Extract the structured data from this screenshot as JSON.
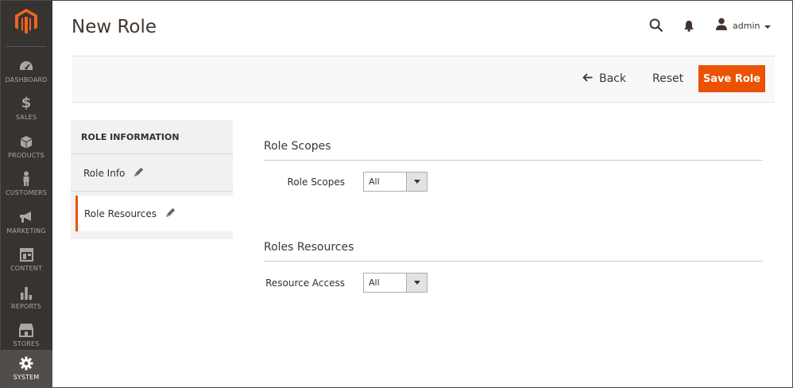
{
  "app": {
    "brand_color": "#eb5202",
    "sidebar_color": "#373330",
    "logo_icon": "magento-logo-icon"
  },
  "sidebar": {
    "items": [
      {
        "label": "DASHBOARD",
        "icon": "dashboard-icon"
      },
      {
        "label": "SALES",
        "icon": "dollar-icon"
      },
      {
        "label": "PRODUCTS",
        "icon": "cube-icon"
      },
      {
        "label": "CUSTOMERS",
        "icon": "person-icon"
      },
      {
        "label": "MARKETING",
        "icon": "megaphone-icon"
      },
      {
        "label": "CONTENT",
        "icon": "layout-icon"
      },
      {
        "label": "REPORTS",
        "icon": "bar-chart-icon"
      },
      {
        "label": "STORES",
        "icon": "store-icon"
      },
      {
        "label": "SYSTEM",
        "icon": "gear-icon",
        "active": true
      }
    ]
  },
  "header": {
    "title": "New Role",
    "user": "admin"
  },
  "actions": {
    "back_label": "Back",
    "reset_label": "Reset",
    "save_label": "Save Role"
  },
  "tabs": {
    "title": "ROLE INFORMATION",
    "items": [
      {
        "label": "Role Info"
      },
      {
        "label": "Role Resources",
        "active": true
      }
    ]
  },
  "form": {
    "scopes_section": {
      "title": "Role Scopes",
      "field_label": "Role Scopes",
      "value": "All"
    },
    "resources_section": {
      "title": "Roles Resources",
      "field_label": "Resource Access",
      "value": "All"
    }
  }
}
